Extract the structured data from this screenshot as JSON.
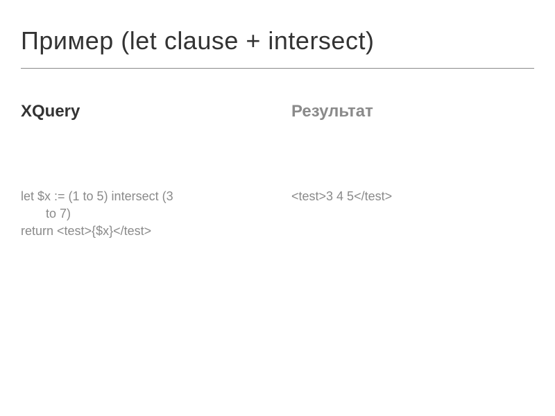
{
  "slide": {
    "title": "Пример (let clause + intersect)"
  },
  "left": {
    "heading": "XQuery",
    "code": {
      "line1": "let $x := (1 to 5) intersect (3",
      "line2": "to 7)",
      "line3": "return <test>{$x}</test>"
    }
  },
  "right": {
    "heading": "Результат",
    "output": "<test>3 4 5</test>"
  }
}
